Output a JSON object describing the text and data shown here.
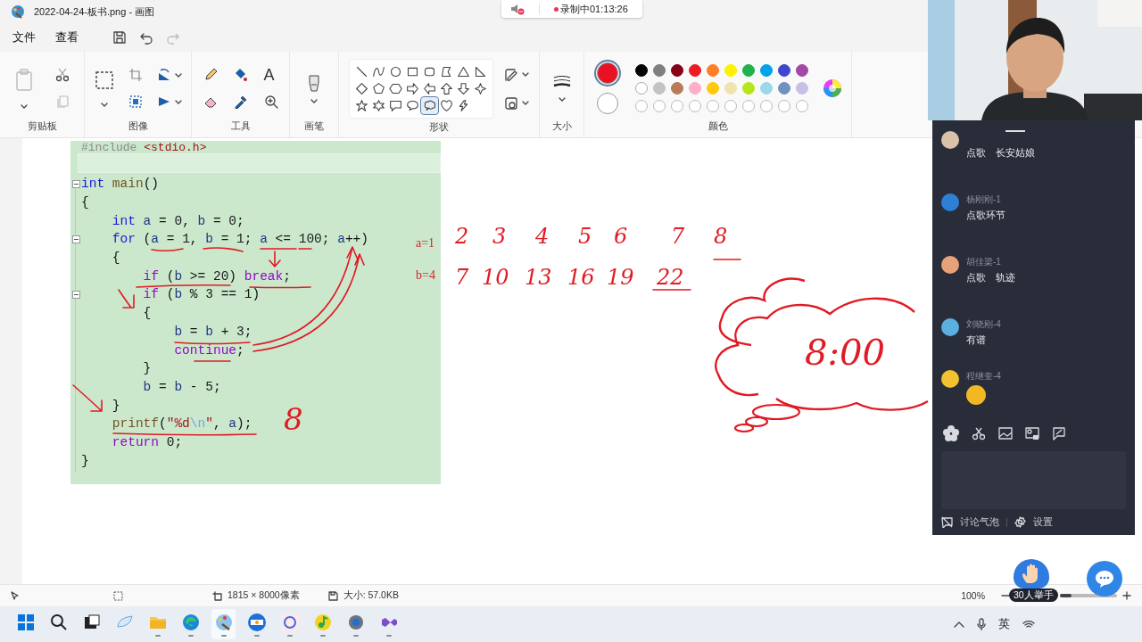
{
  "window": {
    "title": "2022-04-24-板书.png - 画图"
  },
  "recording": {
    "label": "录制中01:13:26"
  },
  "menu": [
    {
      "label": "文件"
    },
    {
      "label": "查看"
    }
  ],
  "ribbon_groups": [
    {
      "label": "剪贴板"
    },
    {
      "label": "图像"
    },
    {
      "label": "工具"
    },
    {
      "label": "画笔"
    },
    {
      "label": "形状"
    },
    {
      "label": "大小"
    },
    {
      "label": "颜色"
    }
  ],
  "text_tool": "A",
  "shapes": [
    {
      "kind": "line",
      "selected": false
    },
    {
      "kind": "curve",
      "selected": false
    },
    {
      "kind": "oval",
      "selected": false
    },
    {
      "kind": "rect",
      "selected": false
    },
    {
      "kind": "rounded",
      "selected": false
    },
    {
      "kind": "polygon",
      "selected": false
    },
    {
      "kind": "triangle",
      "selected": false
    },
    {
      "kind": "right-triangle",
      "selected": false
    },
    {
      "kind": "diamond",
      "selected": false
    },
    {
      "kind": "pentagon",
      "selected": false
    },
    {
      "kind": "hexagon",
      "selected": false
    },
    {
      "kind": "arrow-right",
      "selected": false
    },
    {
      "kind": "arrow-left",
      "selected": false
    },
    {
      "kind": "arrow-up",
      "selected": false
    },
    {
      "kind": "arrow-down",
      "selected": false
    },
    {
      "kind": "star4",
      "selected": false
    },
    {
      "kind": "star5",
      "selected": false
    },
    {
      "kind": "star6",
      "selected": false
    },
    {
      "kind": "callout-rect",
      "selected": false
    },
    {
      "kind": "callout-oval",
      "selected": false
    },
    {
      "kind": "callout-cloud",
      "selected": true
    },
    {
      "kind": "heart",
      "selected": false
    },
    {
      "kind": "lightning",
      "selected": false
    }
  ],
  "current_colors": [
    {
      "color": "#e81224",
      "selected": true
    },
    {
      "color": "#ffffff",
      "selected": false
    }
  ],
  "palette": [
    {
      "color": "#000000"
    },
    {
      "color": "#7f7f7f"
    },
    {
      "color": "#880015"
    },
    {
      "color": "#ed1c24"
    },
    {
      "color": "#ff7f27"
    },
    {
      "color": "#fff200"
    },
    {
      "color": "#22b14c"
    },
    {
      "color": "#00a2e8"
    },
    {
      "color": "#3f48cc"
    },
    {
      "color": "#a349a4"
    },
    {
      "color": "#ffffff"
    },
    {
      "color": "#c3c3c3"
    },
    {
      "color": "#b97a57"
    },
    {
      "color": "#ffaec9"
    },
    {
      "color": "#ffc90e"
    },
    {
      "color": "#efe4b0"
    },
    {
      "color": "#b5e61d"
    },
    {
      "color": "#99d9ea"
    },
    {
      "color": "#7092be"
    },
    {
      "color": "#c8bfe7"
    }
  ],
  "code": [
    {
      "fold": false,
      "current": false,
      "tokens": [
        {
          "text": "#include",
          "kind": "pre"
        },
        {
          "text": " <stdio.h>",
          "kind": "str"
        }
      ]
    },
    {
      "fold": false,
      "current": true
    },
    {
      "fold": true,
      "current": false,
      "tokens": [
        {
          "text": "int",
          "kind": "type"
        },
        {
          "text": " main",
          "kind": "fn"
        },
        {
          "text": "()",
          "kind": "plain"
        }
      ]
    },
    {
      "fold": false,
      "current": false,
      "tokens": [
        {
          "text": "{",
          "kind": "plain"
        }
      ]
    },
    {
      "fold": false,
      "current": false,
      "tokens": [
        {
          "text": "    int",
          "kind": "type"
        },
        {
          "text": " a",
          "kind": "var"
        },
        {
          "text": " = ",
          "kind": "plain"
        },
        {
          "text": "0",
          "kind": "num"
        },
        {
          "text": ", ",
          "kind": "plain"
        },
        {
          "text": "b",
          "kind": "var"
        },
        {
          "text": " = ",
          "kind": "plain"
        },
        {
          "text": "0",
          "kind": "num"
        },
        {
          "text": ";",
          "kind": "plain"
        }
      ]
    },
    {
      "fold": true,
      "current": false,
      "tokens": [
        {
          "text": "    for",
          "kind": "type"
        },
        {
          "text": " (",
          "kind": "plain"
        },
        {
          "text": "a",
          "kind": "var"
        },
        {
          "text": " = ",
          "kind": "plain"
        },
        {
          "text": "1",
          "kind": "num"
        },
        {
          "text": ", ",
          "kind": "plain"
        },
        {
          "text": "b",
          "kind": "var"
        },
        {
          "text": " = ",
          "kind": "plain"
        },
        {
          "text": "1",
          "kind": "num"
        },
        {
          "text": "; ",
          "kind": "plain"
        },
        {
          "text": "a",
          "kind": "var"
        },
        {
          "text": " <= ",
          "kind": "plain"
        },
        {
          "text": "100",
          "kind": "num"
        },
        {
          "text": "; ",
          "kind": "plain"
        },
        {
          "text": "a",
          "kind": "var"
        },
        {
          "text": "++)",
          "kind": "plain"
        }
      ]
    },
    {
      "fold": false,
      "current": false,
      "tokens": [
        {
          "text": "    {",
          "kind": "plain"
        }
      ]
    },
    {
      "fold": false,
      "current": false,
      "tokens": [
        {
          "text": "        if",
          "kind": "ctl"
        },
        {
          "text": " (",
          "kind": "plain"
        },
        {
          "text": "b",
          "kind": "var"
        },
        {
          "text": " >= ",
          "kind": "plain"
        },
        {
          "text": "20",
          "kind": "num"
        },
        {
          "text": ") ",
          "kind": "plain"
        },
        {
          "text": "break",
          "kind": "ctl"
        },
        {
          "text": ";",
          "kind": "plain"
        }
      ]
    },
    {
      "fold": true,
      "current": false,
      "tokens": [
        {
          "text": "        if",
          "kind": "ctl"
        },
        {
          "text": " (",
          "kind": "plain"
        },
        {
          "text": "b",
          "kind": "var"
        },
        {
          "text": " % ",
          "kind": "plain"
        },
        {
          "text": "3",
          "kind": "num"
        },
        {
          "text": " == ",
          "kind": "plain"
        },
        {
          "text": "1",
          "kind": "num"
        },
        {
          "text": ")",
          "kind": "plain"
        }
      ]
    },
    {
      "fold": false,
      "current": false,
      "tokens": [
        {
          "text": "        {",
          "kind": "plain"
        }
      ]
    },
    {
      "fold": false,
      "current": false,
      "tokens": [
        {
          "text": "            b",
          "kind": "var"
        },
        {
          "text": " = ",
          "kind": "plain"
        },
        {
          "text": "b",
          "kind": "var"
        },
        {
          "text": " + ",
          "kind": "plain"
        },
        {
          "text": "3",
          "kind": "num"
        },
        {
          "text": ";",
          "kind": "plain"
        }
      ]
    },
    {
      "fold": false,
      "current": false,
      "tokens": [
        {
          "text": "            continue",
          "kind": "ctl"
        },
        {
          "text": ";",
          "kind": "plain"
        }
      ]
    },
    {
      "fold": false,
      "current": false,
      "tokens": [
        {
          "text": "        }",
          "kind": "plain"
        }
      ]
    },
    {
      "fold": false,
      "current": false,
      "tokens": [
        {
          "text": "        b",
          "kind": "var"
        },
        {
          "text": " = ",
          "kind": "plain"
        },
        {
          "text": "b",
          "kind": "var"
        },
        {
          "text": " - ",
          "kind": "plain"
        },
        {
          "text": "5",
          "kind": "num"
        },
        {
          "text": ";",
          "kind": "plain"
        }
      ]
    },
    {
      "fold": false,
      "current": false,
      "tokens": [
        {
          "text": "    }",
          "kind": "plain"
        }
      ]
    },
    {
      "fold": false,
      "current": false,
      "tokens": [
        {
          "text": "    printf",
          "kind": "fn"
        },
        {
          "text": "(",
          "kind": "plain"
        },
        {
          "text": "\"%d",
          "kind": "str"
        },
        {
          "text": "\\n",
          "kind": "esc"
        },
        {
          "text": "\"",
          "kind": "str"
        },
        {
          "text": ", ",
          "kind": "plain"
        },
        {
          "text": "a",
          "kind": "var"
        },
        {
          "text": ");",
          "kind": "plain"
        }
      ]
    },
    {
      "fold": false,
      "current": false,
      "tokens": [
        {
          "text": "    return",
          "kind": "ctl"
        },
        {
          "text": " 0",
          "kind": "num"
        },
        {
          "text": ";",
          "kind": "plain"
        }
      ]
    },
    {
      "fold": false,
      "current": false,
      "tokens": [
        {
          "text": "}",
          "kind": "plain"
        }
      ]
    }
  ],
  "ink": {
    "labels": [
      "a=1",
      "b=4"
    ],
    "a_values": [
      "2",
      "3",
      "4",
      "5",
      "6",
      "7",
      "8"
    ],
    "b_values": [
      "7",
      "10",
      "13",
      "16",
      "19",
      "22"
    ],
    "answer": "8",
    "thought": "8:00"
  },
  "chat": {
    "messages": [
      {
        "kind": "text",
        "color": "#d9c2a8",
        "text": "点歌　长安姑娘"
      },
      {
        "kind": "text",
        "name": "杨刚刚-1",
        "color": "#2e7fd6",
        "text": "点歌环节"
      },
      {
        "kind": "text",
        "name": "胡佳梁-1",
        "color": "#e8a27a",
        "text": "点歌　轨迹"
      },
      {
        "kind": "text",
        "name": "刘晓刚-4",
        "color": "#5bb0e0",
        "text": "有谱"
      },
      {
        "kind": "emoji",
        "name": "程继奎-4",
        "color": "#f2c230"
      }
    ],
    "footer": [
      "讨论气泡",
      "设置"
    ]
  },
  "status": {
    "dimensions": "1815 × 8000像素",
    "file_size": "大小: 57.0KB",
    "zoom": "100%",
    "zoom_slider": {
      "level": 0.2
    }
  },
  "hands": {
    "label": "30人举手"
  },
  "taskbar": {
    "apps": [
      {
        "kind": "start",
        "selected": false,
        "running": false
      },
      {
        "kind": "search",
        "selected": false,
        "running": false
      },
      {
        "kind": "taskview",
        "selected": false,
        "running": false
      },
      {
        "kind": "widgets",
        "selected": false,
        "running": false
      },
      {
        "kind": "explorer",
        "selected": false,
        "running": true
      },
      {
        "kind": "edge",
        "selected": false,
        "running": true
      },
      {
        "kind": "paint",
        "selected": true,
        "running": true
      },
      {
        "kind": "classroom",
        "selected": false,
        "running": true
      },
      {
        "kind": "meeting",
        "selected": false,
        "running": true
      },
      {
        "kind": "music",
        "selected": false,
        "running": true
      },
      {
        "kind": "settings",
        "selected": false,
        "running": true
      },
      {
        "kind": "vs",
        "selected": false,
        "running": true
      }
    ],
    "ime": "英"
  }
}
